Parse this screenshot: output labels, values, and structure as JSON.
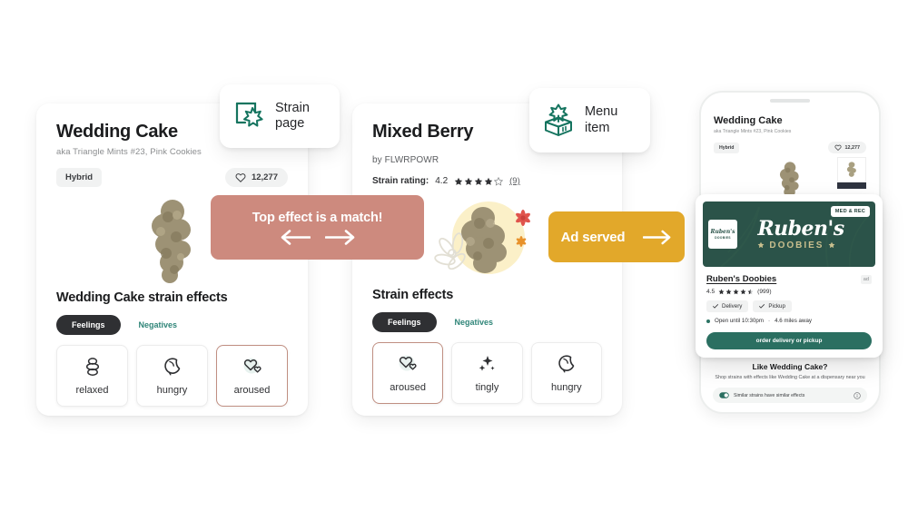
{
  "left_card": {
    "title": "Wedding Cake",
    "aka": "aka Triangle Mints #23, Pink Cookies",
    "type_badge": "Hybrid",
    "likes": "12,277",
    "effects_heading": "Wedding Cake strain effects",
    "tab_active": "Feelings",
    "tab_inactive": "Negatives",
    "effects": [
      {
        "label": "relaxed",
        "icon": "stacked-stones-icon",
        "selected": false
      },
      {
        "label": "hungry",
        "icon": "crescent-moon-icon",
        "selected": false
      },
      {
        "label": "aroused",
        "icon": "two-hearts-icon",
        "selected": true
      }
    ]
  },
  "mid_card": {
    "title": "Mixed Berry",
    "brand": "by FLWRPOWR",
    "rating_label": "Strain rating:",
    "rating_value": "4.2",
    "rating_stars_filled": 4,
    "rating_stars_total": 5,
    "rating_count": "(9)",
    "effects_heading": "Strain effects",
    "tab_active": "Feelings",
    "tab_inactive": "Negatives",
    "effects": [
      {
        "label": "aroused",
        "icon": "two-hearts-icon",
        "selected": true
      },
      {
        "label": "tingly",
        "icon": "sparkles-icon",
        "selected": false
      },
      {
        "label": "hungry",
        "icon": "crescent-moon-icon",
        "selected": false
      }
    ]
  },
  "chips": {
    "strain_page": {
      "line1": "Strain",
      "line2": "page",
      "icon": "strain-page-icon"
    },
    "menu_item": {
      "line1": "Menu",
      "line2": "item",
      "icon": "menu-item-box-icon"
    }
  },
  "banners": {
    "match": {
      "text": "Top effect is a match!",
      "left_arrow": "←",
      "right_arrow": "→",
      "color": "#cd8a7e"
    },
    "ad": {
      "text": "Ad served",
      "arrow": "→",
      "color": "#e2a82a"
    }
  },
  "phone": {
    "title": "Wedding Cake",
    "aka": "aka Triangle Mints #23, Pink Cookies",
    "type_badge": "Hybrid",
    "likes": "12,277",
    "bottom_heading": "Like Wedding Cake?",
    "bottom_text": "Shop strains with effects like Wedding Cake at a dispensary near you",
    "note_text": "Similar strains have similar effects",
    "note_info_icon": "info-circle-icon"
  },
  "ad_card": {
    "badge": "MED & REC",
    "logo_script": "Ruben's",
    "logo_sub": "DOOBIES",
    "logo_box_line1": "Ruben's",
    "logo_box_line2": "DOOBIES",
    "name": "Ruben's Doobies",
    "ad_tag": "ad",
    "rating_value": "4.5",
    "rating_count": "(999)",
    "rating_stars_filled": 4,
    "rating_stars_half": 1,
    "chips": [
      "Delivery",
      "Pickup"
    ],
    "open_text": "Open until 10:30pm",
    "separator": "·",
    "distance_text": "4.6 miles away",
    "cta": "order delivery or pickup",
    "brand_green": "#2b5349",
    "cta_green": "#2b6f61"
  }
}
